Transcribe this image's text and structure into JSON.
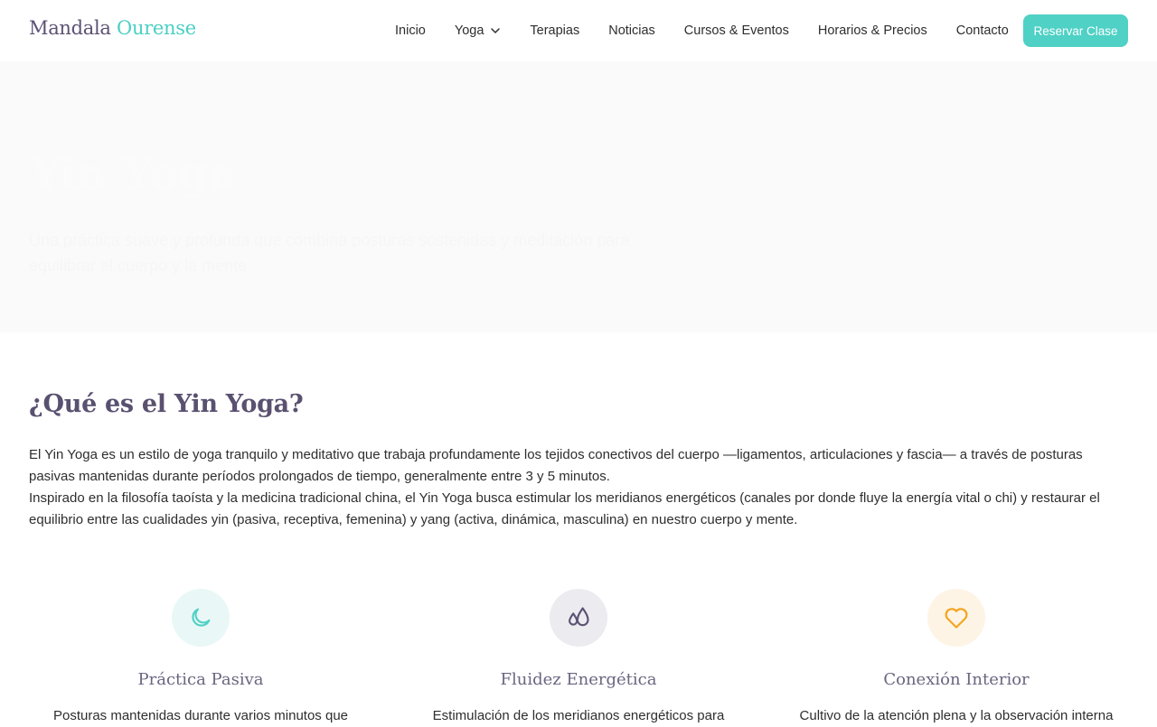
{
  "header": {
    "logo_part1": "Mandala",
    "logo_part2": "Ourense",
    "nav": [
      "Inicio",
      "Yoga",
      "Terapias",
      "Noticias",
      "Cursos & Eventos",
      "Horarios & Precios",
      "Contacto"
    ],
    "cta_label": "Reservar Clase"
  },
  "hero": {
    "title": "Yin Yoga",
    "subtitle": "Una práctica suave y profunda que combina posturas sostenidas y meditación para equilibrar el cuerpo y la mente"
  },
  "intro": {
    "title": "¿Qué es el Yin Yoga?",
    "paragraph1": "El Yin Yoga es un estilo de yoga tranquilo y meditativo que trabaja profundamente los tejidos conectivos del cuerpo —ligamentos, articulaciones y fascia— a través de posturas pasivas mantenidas durante períodos prolongados de tiempo, generalmente entre 3 y 5 minutos.",
    "paragraph2": "Inspirado en la filosofía taoísta y la medicina tradicional china, el Yin Yoga busca estimular los meridianos energéticos (canales por donde fluye la energía vital o chi) y restaurar el equilibrio entre las cualidades yin (pasiva, receptiva, femenina) y yang (activa, dinámica, masculina) en nuestro cuerpo y mente."
  },
  "features": [
    {
      "icon": "moon-icon",
      "title": "Práctica Pasiva",
      "text": "Posturas mantenidas durante varios minutos que"
    },
    {
      "icon": "water-drops-icon",
      "title": "Fluidez Energética",
      "text": "Estimulación de los meridianos energéticos para"
    },
    {
      "icon": "heart-icon",
      "title": "Conexión Interior",
      "text": "Cultivo de la atención plena y la observación interna"
    }
  ],
  "colors": {
    "accent": "#4fd1c5",
    "purple": "#5c5273",
    "orange": "#f5a623"
  }
}
